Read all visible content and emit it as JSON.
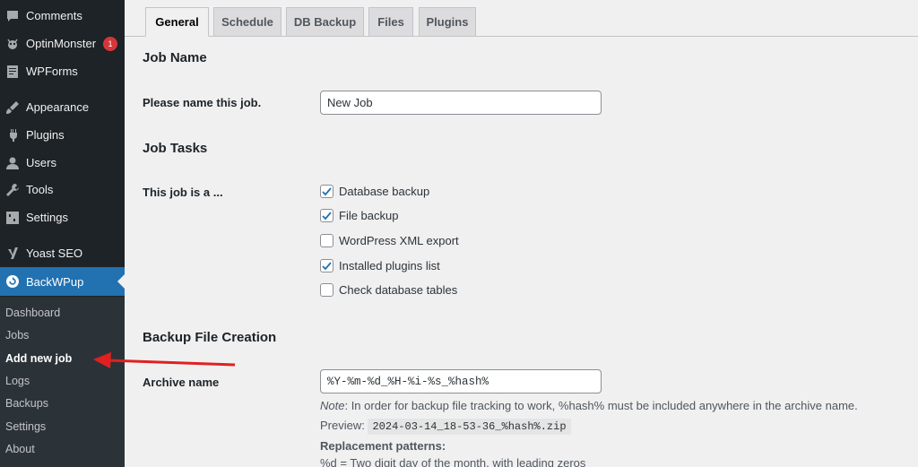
{
  "sidebar": {
    "items": [
      {
        "label": "Comments",
        "icon": "comments-icon"
      },
      {
        "label": "OptinMonster",
        "icon": "optinmonster-icon",
        "badge": "1"
      },
      {
        "label": "WPForms",
        "icon": "wpforms-icon"
      },
      {
        "label": "Appearance",
        "icon": "appearance-icon"
      },
      {
        "label": "Plugins",
        "icon": "plugins-icon"
      },
      {
        "label": "Users",
        "icon": "users-icon"
      },
      {
        "label": "Tools",
        "icon": "tools-icon"
      },
      {
        "label": "Settings",
        "icon": "settings-icon"
      },
      {
        "label": "Yoast SEO",
        "icon": "yoast-icon"
      },
      {
        "label": "BackWPup",
        "icon": "backwpup-icon"
      }
    ],
    "submenu": [
      "Dashboard",
      "Jobs",
      "Add new job",
      "Logs",
      "Backups",
      "Settings",
      "About"
    ],
    "accent": "#2271b1"
  },
  "tabs": [
    "General",
    "Schedule",
    "DB Backup",
    "Files",
    "Plugins"
  ],
  "job_name": {
    "heading": "Job Name",
    "label": "Please name this job.",
    "value": "New Job"
  },
  "job_tasks": {
    "heading": "Job Tasks",
    "label": "This job is a ...",
    "options": [
      {
        "label": "Database backup",
        "checked": true
      },
      {
        "label": "File backup",
        "checked": true
      },
      {
        "label": "WordPress XML export",
        "checked": false
      },
      {
        "label": "Installed plugins list",
        "checked": true
      },
      {
        "label": "Check database tables",
        "checked": false
      }
    ]
  },
  "backup_file": {
    "heading": "Backup File Creation",
    "archive_label": "Archive name",
    "archive_value": "%Y-%m-%d_%H-%i-%s_%hash%",
    "note_prefix": "Note",
    "note_text": ": In order for backup file tracking to work, %hash% must be included anywhere in the archive name.",
    "preview_label": "Preview:",
    "preview_value": "2024-03-14_18-53-36_%hash%.zip",
    "patterns_label": "Replacement patterns:",
    "pattern_line": "%d = Two digit day of the month, with leading zeros"
  }
}
